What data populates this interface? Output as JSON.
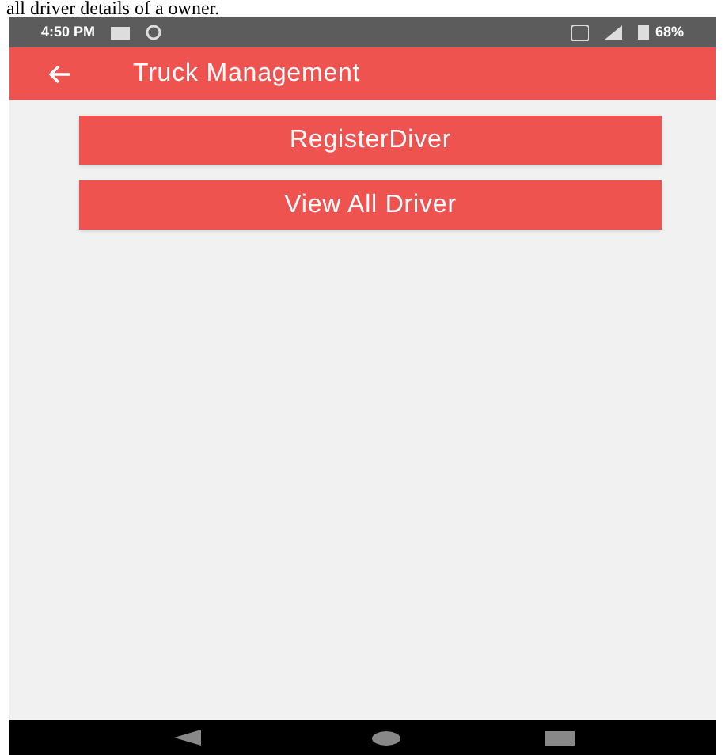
{
  "caption": "all driver details of a owner.",
  "status_bar": {
    "time": "4:50 PM",
    "battery": "68%"
  },
  "app_bar": {
    "title": "Truck Management"
  },
  "buttons": [
    {
      "label": "RegisterDiver"
    },
    {
      "label": "View All Driver"
    }
  ]
}
